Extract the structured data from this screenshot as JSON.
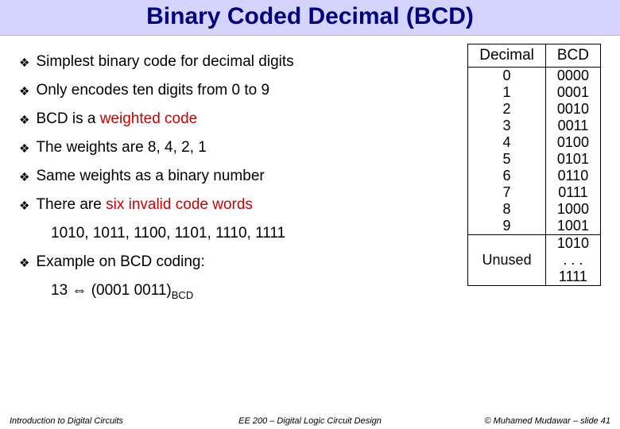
{
  "title": "Binary Coded Decimal (BCD)",
  "bullets": {
    "b1": "Simplest binary code for decimal digits",
    "b2": "Only encodes ten digits from 0 to 9",
    "b3_pre": "BCD is a ",
    "b3_red": "weighted code",
    "b4": "The weights are 8, 4, 2, 1",
    "b5": "Same weights as a binary number",
    "b6_pre": "There are ",
    "b6_red": "six invalid code words",
    "b6_sub": "1010, 1011, 1100, 1101, 1110, 1111",
    "b7": "Example on BCD coding:",
    "b7_sub_pre": "13  ",
    "b7_sub_arrow": "⇔",
    "b7_sub_post": " (0001 0011)",
    "b7_sub_subscript": "BCD"
  },
  "table": {
    "head_dec": "Decimal",
    "head_bcd": "BCD",
    "rows": [
      {
        "d": "0",
        "b": "0000"
      },
      {
        "d": "1",
        "b": "0001"
      },
      {
        "d": "2",
        "b": "0010"
      },
      {
        "d": "3",
        "b": "0011"
      },
      {
        "d": "4",
        "b": "0100"
      },
      {
        "d": "5",
        "b": "0101"
      },
      {
        "d": "6",
        "b": "0110"
      },
      {
        "d": "7",
        "b": "0111"
      },
      {
        "d": "8",
        "b": "1000"
      },
      {
        "d": "9",
        "b": "1001"
      }
    ],
    "unused_label": "Unused",
    "unused_b1": "1010",
    "unused_b2": ". . .",
    "unused_b3": "1111"
  },
  "footer": {
    "left": "Introduction to Digital Circuits",
    "center": "EE 200 – Digital Logic Circuit Design",
    "right": "© Muhamed Mudawar – slide 41"
  }
}
